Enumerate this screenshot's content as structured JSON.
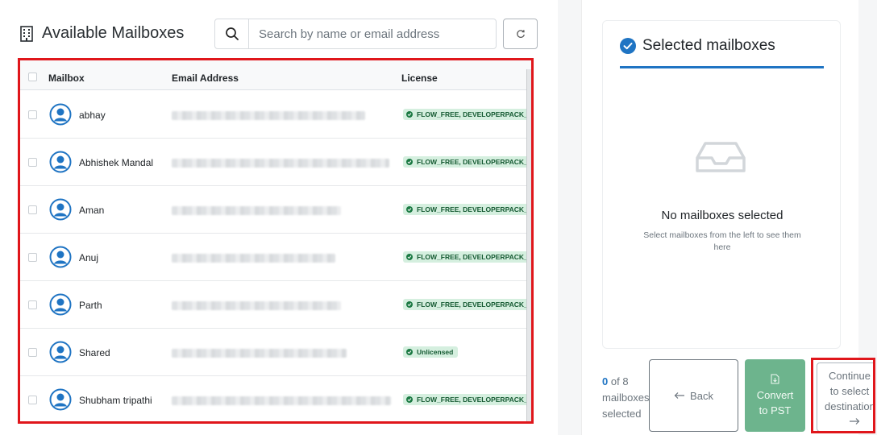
{
  "left": {
    "title": "Available Mailboxes",
    "search": {
      "placeholder": "Search by name or email address",
      "value": ""
    }
  },
  "table": {
    "headers": {
      "mailbox": "Mailbox",
      "email": "Email Address",
      "license": "License"
    },
    "rows": [
      {
        "name": "abhay",
        "license": "FLOW_FREE, DEVELOPERPACK_E",
        "licensed": true
      },
      {
        "name": "Abhishek Mandal",
        "license": "FLOW_FREE, DEVELOPERPACK_E",
        "licensed": true
      },
      {
        "name": "Aman",
        "license": "FLOW_FREE, DEVELOPERPACK_E",
        "licensed": true
      },
      {
        "name": "Anuj",
        "license": "FLOW_FREE, DEVELOPERPACK_E",
        "licensed": true
      },
      {
        "name": "Parth",
        "license": "FLOW_FREE, DEVELOPERPACK_E",
        "licensed": true
      },
      {
        "name": "Shared",
        "license": "Unlicensed",
        "licensed": false
      },
      {
        "name": "Shubham tripathi",
        "license": "FLOW_FREE, DEVELOPERPACK_E",
        "licensed": true
      }
    ]
  },
  "selected": {
    "title": "Selected mailboxes",
    "empty_title": "No mailboxes selected",
    "empty_sub": "Select mailboxes from the left to see them here"
  },
  "footer": {
    "count_selected": "0",
    "count_of": "of 8",
    "count_label": "mailboxes selected",
    "back_label": "Back",
    "convert_label": "Convert to PST",
    "continue_label": "Continue to select destination"
  },
  "colors": {
    "accent": "#1f74c3",
    "highlight": "#e0161b",
    "license_badge": "#d5efdf",
    "convert_button": "#6db48d"
  },
  "icons": [
    "building-icon",
    "search-icon",
    "refresh-icon",
    "user-avatar-icon",
    "check-circle-icon",
    "inbox-icon",
    "arrow-left-icon",
    "download-file-icon",
    "arrow-right-icon"
  ]
}
